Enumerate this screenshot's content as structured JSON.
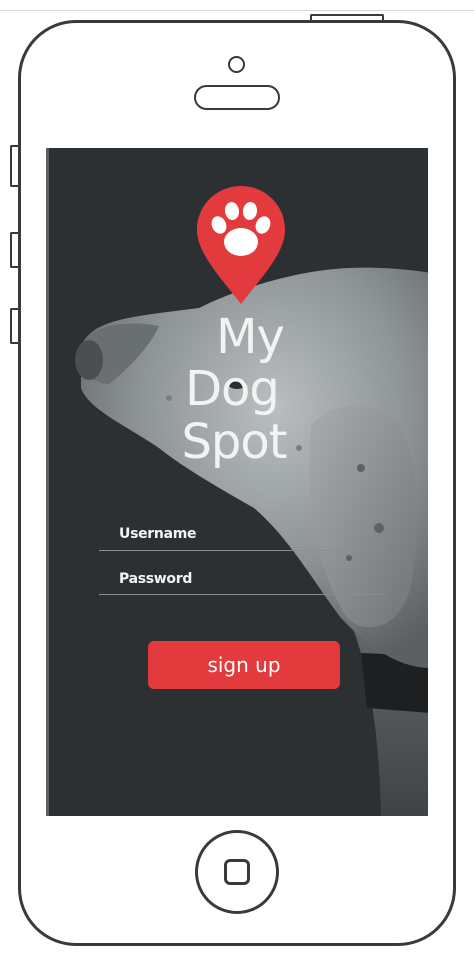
{
  "app": {
    "brand_line1": "My",
    "brand_line2": "Dog",
    "brand_line3": "Spot",
    "logo_icon": "paw-location-pin"
  },
  "form": {
    "username_label": "Username",
    "password_label": "Password",
    "signup_label": "sign up"
  },
  "colors": {
    "accent": "#e33b3d",
    "screen_background": "#2d3032",
    "text": "#f3f3f3"
  }
}
